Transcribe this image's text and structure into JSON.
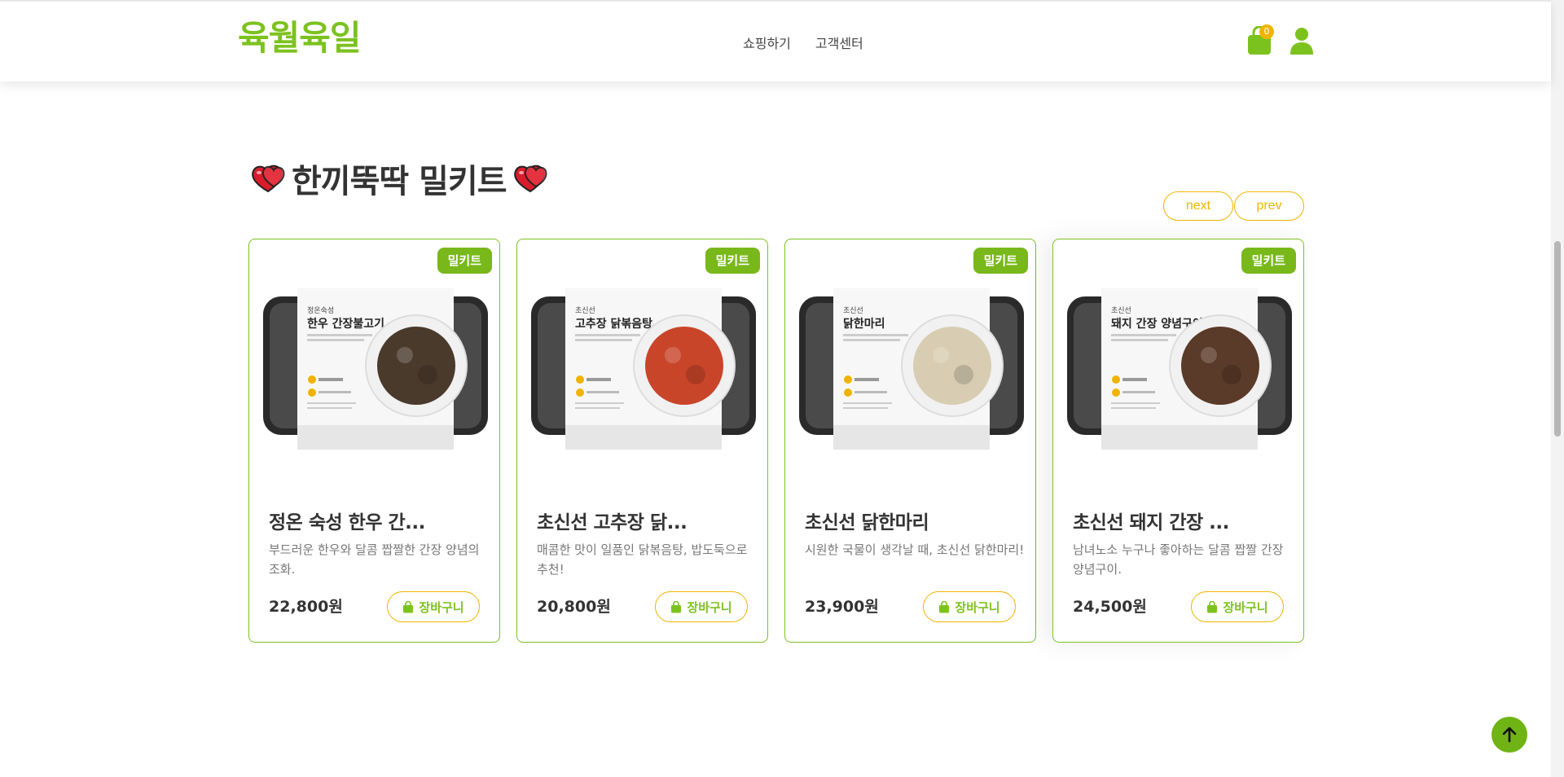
{
  "header": {
    "logo": "육월육일",
    "nav": [
      "쇼핑하기",
      "고객센터"
    ],
    "cart_count": "0"
  },
  "section": {
    "title": "한끼뚝딱 밀키트",
    "next_label": "next",
    "prev_label": "prev"
  },
  "products": [
    {
      "badge": "밀키트",
      "name": "정온 숙성 한우 간...",
      "desc": "부드러운 한우와 달콤 짭짤한 간장 양념의 조화.",
      "price": "22,800원",
      "cart_label": "장바구니",
      "pkg_brand": "정온숙성",
      "pkg_title": "한우 간장불고기",
      "food_color": "#4a3a2c"
    },
    {
      "badge": "밀키트",
      "name": "초신선 고추장 닭...",
      "desc": "매콤한 맛이 일품인 닭볶음탕, 밥도둑으로 추천!",
      "price": "20,800원",
      "cart_label": "장바구니",
      "pkg_brand": "초신선",
      "pkg_title": "고추장 닭볶음탕",
      "food_color": "#c9452a"
    },
    {
      "badge": "밀키트",
      "name": "초신선 닭한마리",
      "desc": "시원한 국물이 생각날 때, 초신선 닭한마리!",
      "price": "23,900원",
      "cart_label": "장바구니",
      "pkg_brand": "초신선",
      "pkg_title": "닭한마리",
      "food_color": "#d8cdb2"
    },
    {
      "badge": "밀키트",
      "name": "초신선 돼지 간장 ...",
      "desc": "남녀노소 누구나 좋아하는 달콤 짭짤 간장 양념구이.",
      "price": "24,500원",
      "cart_label": "장바구니",
      "pkg_brand": "초신선",
      "pkg_title": "돼지 간장 양념구이",
      "food_color": "#5a3a28"
    }
  ],
  "colors": {
    "brand_green": "#7cc21f",
    "accent_yellow": "#f0b400"
  }
}
